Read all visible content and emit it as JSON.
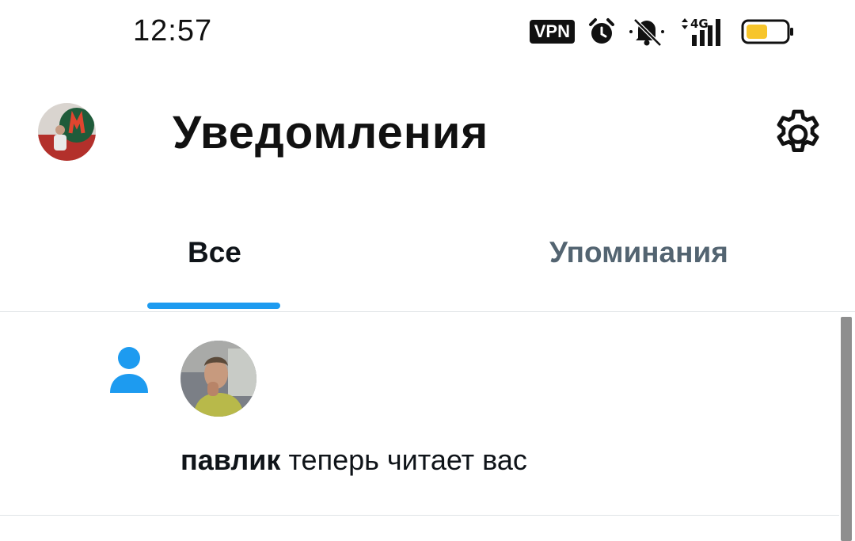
{
  "status_bar": {
    "time": "12:57",
    "vpn_label": "VPN",
    "network_label": "4G",
    "icons": [
      "vpn-badge",
      "alarm-icon",
      "mute-icon",
      "signal-icon",
      "battery-icon"
    ],
    "battery_color": "#f7c52b"
  },
  "header": {
    "title": "Уведомления",
    "avatar_icon": "profile-avatar",
    "settings_icon": "gear-icon"
  },
  "tabs": [
    {
      "label": "Все",
      "active": true
    },
    {
      "label": "Упоминания",
      "active": false
    }
  ],
  "accent_color": "#1d9bf0",
  "notifications": [
    {
      "type_icon": "person-icon",
      "user": "павлик",
      "text": "теперь читает вас"
    }
  ]
}
